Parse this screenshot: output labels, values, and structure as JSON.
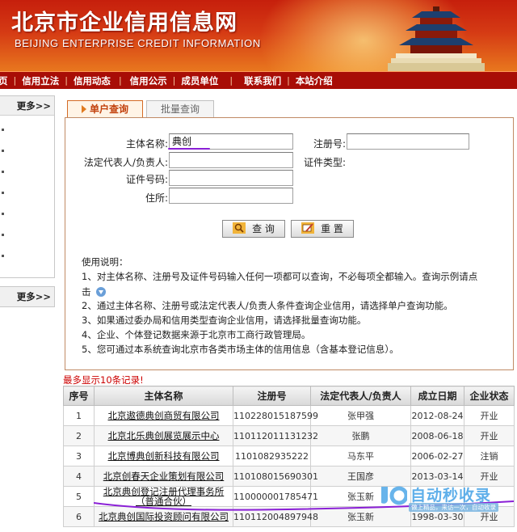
{
  "banner": {
    "title": "北京市企业信用信息网",
    "subtitle": "BEIJING ENTERPRISE CREDIT INFORMATION"
  },
  "nav": {
    "items": [
      "信用立法",
      "信用动态",
      "信用公示",
      "成员单位",
      "联系我们",
      "本站介绍"
    ]
  },
  "left": {
    "more_label_1": "更多>>",
    "more_label_2": "更多>>"
  },
  "tabs": {
    "active": "单户查询",
    "inactive": "批量查询"
  },
  "form": {
    "subject_name_label": "主体名称:",
    "subject_name_value": "典创",
    "reg_no_label": "注册号:",
    "reg_no_value": "",
    "legal_rep_label": "法定代表人/负责人:",
    "legal_rep_value": "",
    "cert_type_label": "证件类型:",
    "cert_no_label": "证件号码:",
    "cert_no_value": "",
    "address_label": "住所:",
    "address_value": "",
    "query_button": "查 询",
    "reset_button": "重 置"
  },
  "usage": {
    "heading": "使用说明：",
    "lines": [
      "1、对主体名称、注册号及证件号码输入任何一项都可以查询，不必每项全都输入。查询示例请点",
      "击",
      "2、通过主体名称、注册号或法定代表人/负责人条件查询企业信用，请选择单户查询功能。",
      "3、如果通过委办局和信用类型查询企业信用，请选择批量查询功能。",
      "4、企业、个体登记数据来源于北京市工商行政管理局。",
      "5、您可通过本系统查询北京市各类市场主体的信用信息（含基本登记信息）。"
    ]
  },
  "results": {
    "notice": "最多显示10条记录!",
    "columns": [
      "序号",
      "主体名称",
      "注册号",
      "法定代表人/负责人",
      "成立日期",
      "企业状态"
    ],
    "rows": [
      {
        "no": "1",
        "name": "北京遨德典创商贸有限公司",
        "reg": "110228015187599",
        "rep": "张甲强",
        "date": "2012-08-24",
        "status": "开业"
      },
      {
        "no": "2",
        "name": "北京北乐典创展览展示中心",
        "reg": "110112011131232",
        "rep": "张鹏",
        "date": "2008-06-18",
        "status": "开业"
      },
      {
        "no": "3",
        "name": "北京博典创新科技有限公司",
        "reg": "1101082935222",
        "rep": "马东平",
        "date": "2006-02-27",
        "status": "注销"
      },
      {
        "no": "4",
        "name": "北京创春天企业策划有限公司",
        "reg": "110108015690301",
        "rep": "王国彦",
        "date": "2013-03-14",
        "status": "开业"
      },
      {
        "no": "5",
        "name": "北京典创登记注册代理事务所（普通合伙）",
        "reg": "110000001785471",
        "rep": "张玉新",
        "date": "",
        "status": ""
      },
      {
        "no": "6",
        "name": "北京典创国际投资顾问有限公司",
        "reg": "110112004897948",
        "rep": "张玉新",
        "date": "1998-03-30",
        "status": "开业"
      }
    ]
  },
  "watermark": {
    "text": "自动秒收录",
    "sub": "做上精品，来访一次，自动收录"
  },
  "colors": {
    "banner_red": "#c61f0c",
    "nav_red": "#a80d06",
    "tab_orange": "#c2410c",
    "notice_red": "#cc0000",
    "annotation_purple": "#8a1fd6"
  }
}
